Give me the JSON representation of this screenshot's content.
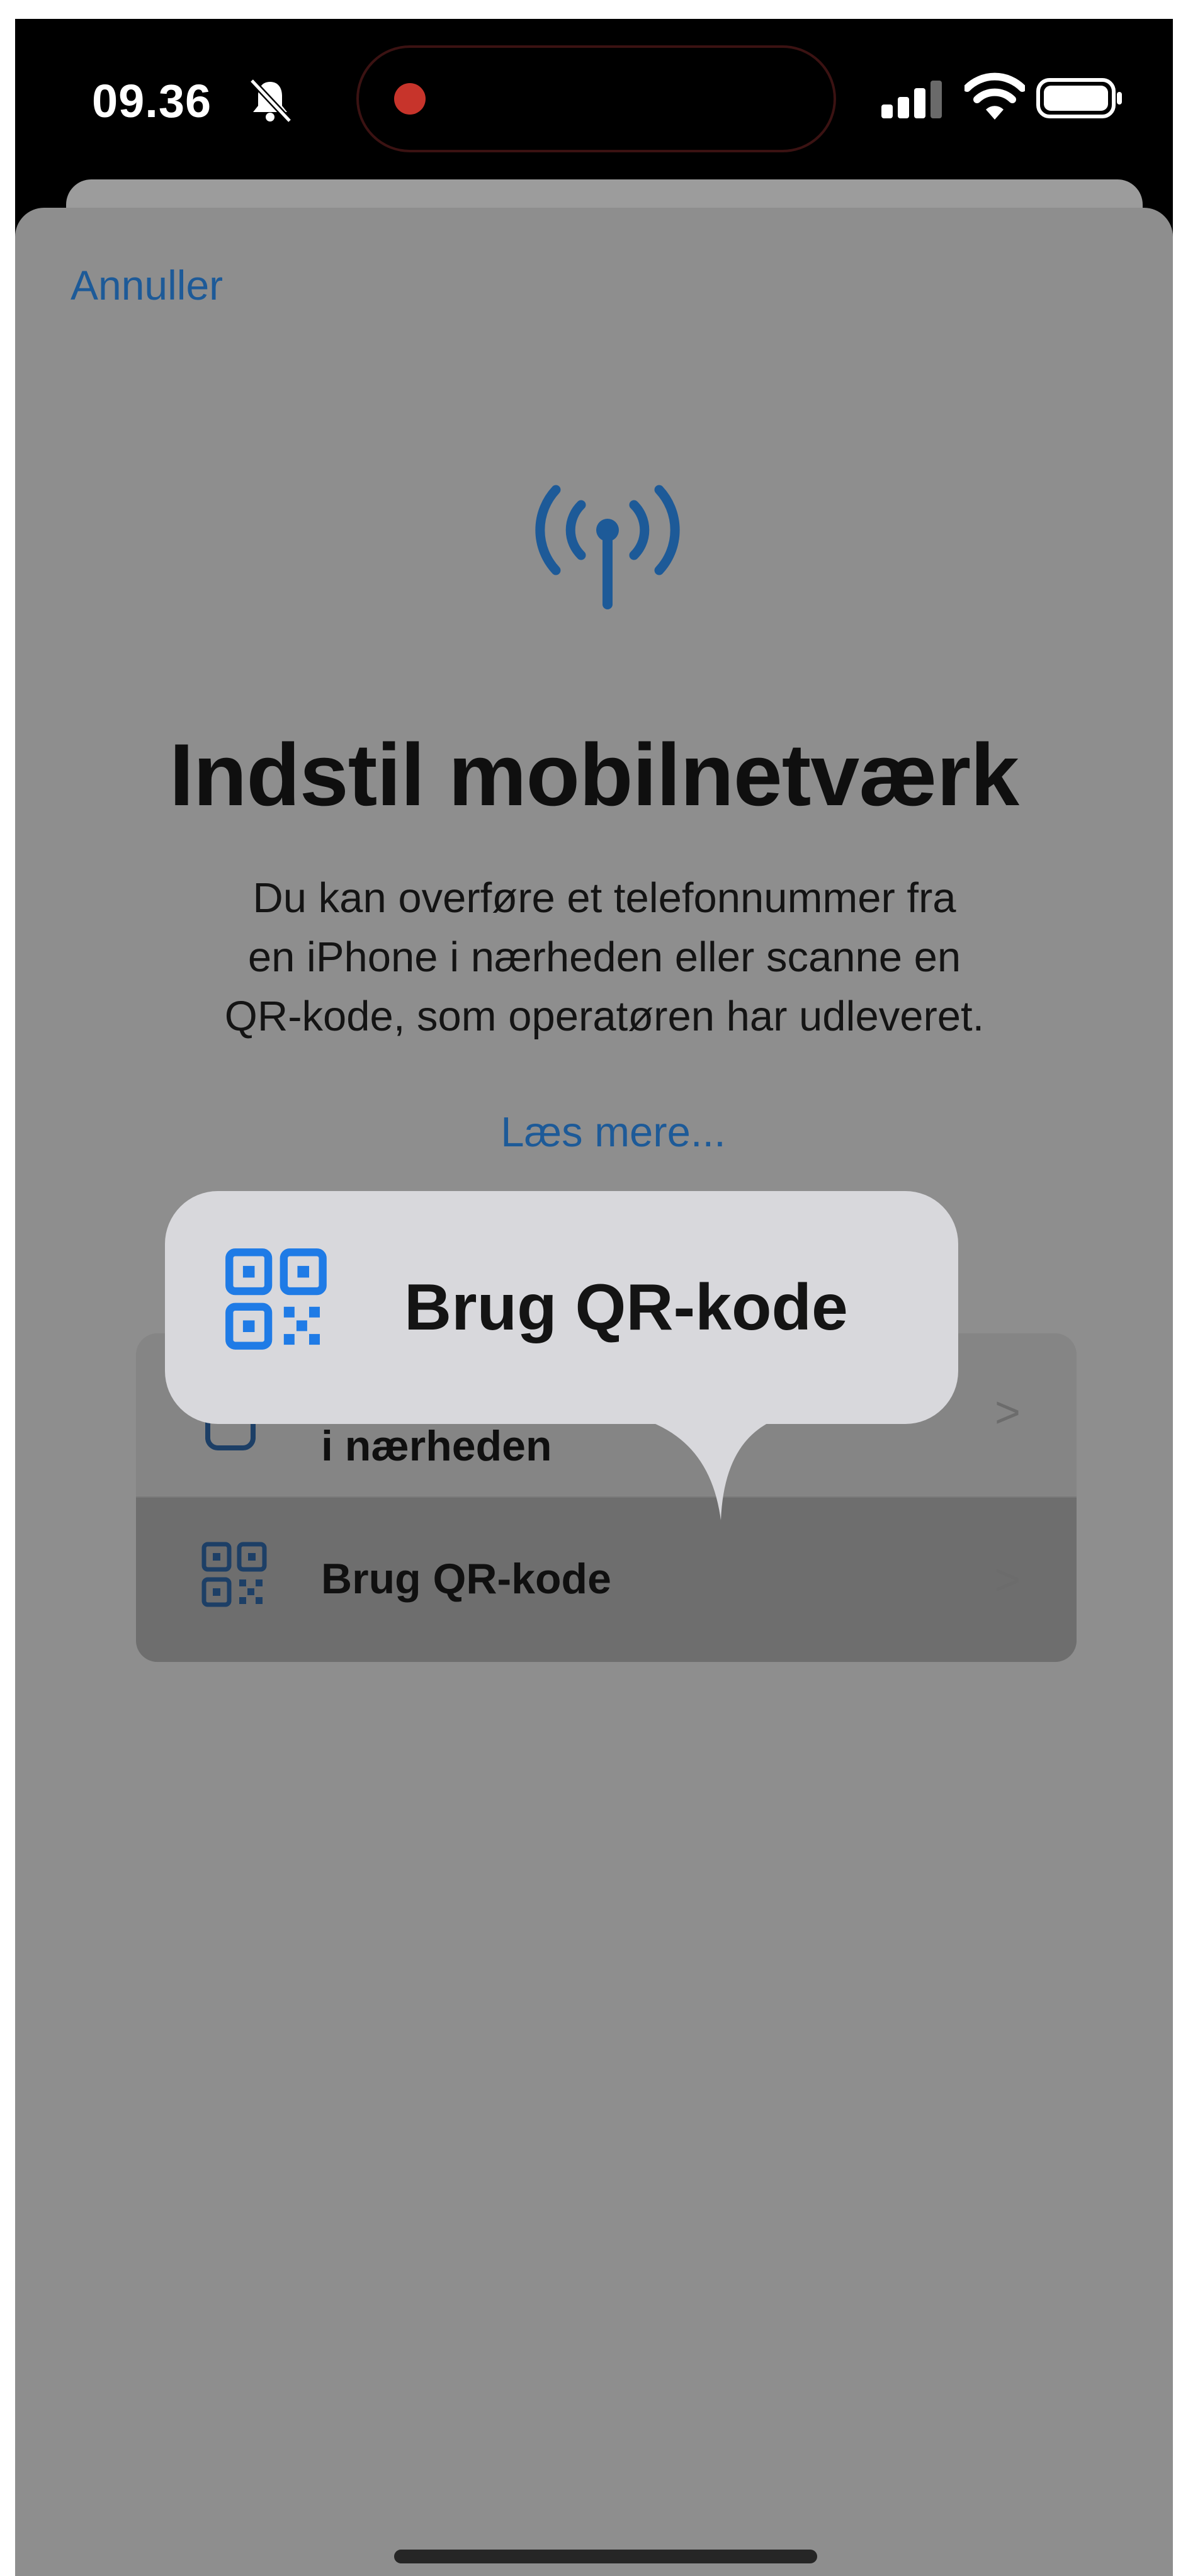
{
  "status_bar": {
    "time": "09.36",
    "icons": [
      "bell-slash-icon",
      "recording-dot-icon",
      "cellular-signal-icon",
      "wifi-icon",
      "battery-icon"
    ]
  },
  "sheet": {
    "cancel_label": "Annuller",
    "header_icon": "antenna-icon",
    "title": "Indstil mobilnetværk",
    "description_lines": [
      "Du kan overføre et telefonnummer fra",
      "en iPhone i nærheden eller scanne en",
      "QR-kode, som operatøren har udleveret."
    ],
    "read_more": "Læs mere..."
  },
  "options": [
    {
      "label": "i nærheden",
      "icon": "phone-icon",
      "chevron": ">"
    },
    {
      "label": "Brug QR-kode",
      "icon": "qr-code-icon",
      "chevron": ">"
    }
  ],
  "popup": {
    "label": "Brug QR-kode",
    "icon": "qr-code-icon"
  },
  "colors": {
    "accent": "#1d5a98",
    "accent_bright": "#1f7be6",
    "overlay": "#8e8e8e",
    "popup_bg": "#d8d8dc"
  }
}
